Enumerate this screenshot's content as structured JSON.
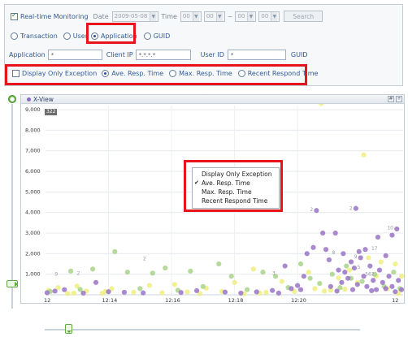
{
  "filters": {
    "realtime_label": "Real-time Monitoring",
    "date_label": "Date",
    "date_value": "2009-05-08",
    "time_label": "Time",
    "hour_from": "00",
    "min_from": "00",
    "tilde": "~",
    "hour_to": "00",
    "min_to": "00",
    "search_label": "Search",
    "view_options": [
      "Transaction",
      "User",
      "Application",
      "GUID"
    ],
    "application_label": "Application",
    "application_value": "*",
    "client_ip_label": "Client IP",
    "client_ip_value": "*.*.*.*",
    "user_id_label": "User ID",
    "user_id_value": "*",
    "guid_label": "GUID",
    "display_only_exception": "Display Only Exception",
    "ave_resp_time": "Ave. Resp. Time",
    "max_resp_time": "Max. Resp. Time",
    "recent_respond_time": "Recent Respond Time"
  },
  "chart_header": {
    "title": "X-View",
    "count_badge": "322"
  },
  "context_menu": {
    "items": [
      "Display Only Exception",
      "Ave. Resp. Time",
      "Max. Resp. Time",
      "Recent Respond Time"
    ],
    "checked": "Ave. Resp. Time"
  },
  "chart_data": {
    "type": "scatter",
    "title": "X-View",
    "xlabel": "",
    "ylabel": "",
    "x_ticks": [
      "12",
      "12:14",
      "12:16",
      "12:18",
      "12:20",
      "12"
    ],
    "y_ticks": [
      "1,000",
      "2,000",
      "3,000",
      "4,000",
      "5,000",
      "6,000",
      "7,000",
      "8,000",
      "9,000"
    ],
    "ylim": [
      0,
      9200
    ],
    "grid": true,
    "colors": {
      "purple": "#9a74c6",
      "green": "#a8d48a",
      "yellow": "#eeee80"
    },
    "series": [
      {
        "color": "purple",
        "points": [
          [
            12.05,
            100
          ],
          [
            12.3,
            180
          ],
          [
            12.6,
            250
          ],
          [
            13.2,
            80
          ],
          [
            13.6,
            600
          ],
          [
            14.0,
            150
          ],
          [
            14.5,
            120
          ],
          [
            15.1,
            90
          ],
          [
            16.3,
            110
          ],
          [
            16.8,
            200
          ],
          [
            17.7,
            130
          ],
          [
            18.2,
            80
          ],
          [
            18.7,
            140
          ],
          [
            19.2,
            210
          ],
          [
            19.6,
            1400
          ],
          [
            19.8,
            300
          ],
          [
            20.0,
            450
          ],
          [
            20.2,
            900
          ],
          [
            20.3,
            2000
          ],
          [
            20.5,
            2300
          ],
          [
            20.6,
            4100
          ],
          [
            20.8,
            3000
          ],
          [
            20.9,
            2200
          ],
          [
            21.0,
            1700
          ],
          [
            21.2,
            3000
          ],
          [
            21.3,
            1200
          ],
          [
            21.4,
            600
          ],
          [
            21.45,
            2000
          ],
          [
            21.5,
            1100
          ],
          [
            21.6,
            800
          ],
          [
            21.7,
            1600
          ],
          [
            21.8,
            1300
          ],
          [
            21.9,
            500
          ],
          [
            21.95,
            2100
          ],
          [
            22.0,
            1800
          ],
          [
            22.1,
            900
          ],
          [
            22.2,
            400
          ],
          [
            22.3,
            1400
          ],
          [
            22.4,
            700
          ],
          [
            22.5,
            250
          ],
          [
            22.6,
            1200
          ],
          [
            22.7,
            600
          ],
          [
            22.8,
            300
          ],
          [
            22.9,
            900
          ],
          [
            23.0,
            400
          ],
          [
            23.1,
            150
          ],
          [
            23.2,
            700
          ],
          [
            23.3,
            250
          ],
          [
            21.85,
            4200
          ],
          [
            22.15,
            2200
          ],
          [
            22.55,
            2800
          ],
          [
            22.8,
            1900
          ],
          [
            23.0,
            2900
          ],
          [
            23.15,
            3200
          ],
          [
            20.1,
            250
          ],
          [
            19.4,
            80
          ],
          [
            21.05,
            400
          ],
          [
            21.25,
            180
          ],
          [
            21.75,
            250
          ],
          [
            22.35,
            200
          ]
        ]
      },
      {
        "color": "green",
        "points": [
          [
            12.15,
            160
          ],
          [
            12.8,
            1150
          ],
          [
            13.1,
            260
          ],
          [
            13.5,
            1250
          ],
          [
            14.2,
            2100
          ],
          [
            14.6,
            1100
          ],
          [
            15.0,
            300
          ],
          [
            15.4,
            1050
          ],
          [
            15.8,
            1300
          ],
          [
            16.2,
            220
          ],
          [
            16.6,
            1150
          ],
          [
            17.0,
            400
          ],
          [
            17.5,
            1500
          ],
          [
            17.9,
            900
          ],
          [
            18.4,
            250
          ],
          [
            18.9,
            1100
          ],
          [
            19.3,
            900
          ],
          [
            19.7,
            350
          ],
          [
            20.1,
            1500
          ],
          [
            20.4,
            800
          ],
          [
            20.7,
            550
          ],
          [
            21.1,
            1000
          ],
          [
            21.35,
            350
          ],
          [
            21.55,
            1400
          ],
          [
            21.7,
            800
          ],
          [
            22.05,
            650
          ],
          [
            22.45,
            1000
          ],
          [
            22.75,
            400
          ],
          [
            23.05,
            1100
          ],
          [
            23.25,
            300
          ]
        ]
      },
      {
        "color": "yellow",
        "points": [
          [
            12.1,
            220
          ],
          [
            12.4,
            350
          ],
          [
            12.7,
            60
          ],
          [
            13.0,
            420
          ],
          [
            13.3,
            180
          ],
          [
            13.8,
            70
          ],
          [
            14.1,
            300
          ],
          [
            14.8,
            120
          ],
          [
            15.3,
            450
          ],
          [
            15.7,
            90
          ],
          [
            16.1,
            500
          ],
          [
            16.5,
            140
          ],
          [
            17.1,
            320
          ],
          [
            17.3,
            5300
          ],
          [
            17.6,
            160
          ],
          [
            18.0,
            600
          ],
          [
            18.3,
            50
          ],
          [
            18.6,
            1250
          ],
          [
            19.0,
            120
          ],
          [
            19.5,
            650
          ],
          [
            19.9,
            160
          ],
          [
            20.35,
            1100
          ],
          [
            20.55,
            300
          ],
          [
            20.85,
            180
          ],
          [
            21.05,
            220
          ],
          [
            21.3,
            820
          ],
          [
            21.5,
            270
          ],
          [
            21.65,
            1200
          ],
          [
            21.9,
            600
          ],
          [
            22.1,
            6800
          ],
          [
            22.25,
            1800
          ],
          [
            22.5,
            900
          ],
          [
            22.65,
            1600
          ],
          [
            22.85,
            300
          ],
          [
            23.1,
            1500
          ],
          [
            23.3,
            900
          ],
          [
            20.75,
            9300
          ],
          [
            12.9,
            80
          ],
          [
            13.9,
            160
          ],
          [
            16.9,
            60
          ],
          [
            18.8,
            80
          ],
          [
            23.2,
            60
          ]
        ]
      }
    ],
    "labeled_points": [
      {
        "x": 12.5,
        "y": 1000,
        "text": "9"
      },
      {
        "x": 15.3,
        "y": 1750,
        "text": "2"
      },
      {
        "x": 13.2,
        "y": 1050,
        "text": "2"
      },
      {
        "x": 19.4,
        "y": 1050,
        "text": "3"
      },
      {
        "x": 20.6,
        "y": 4150,
        "text": "2"
      },
      {
        "x": 21.85,
        "y": 4200,
        "text": "2"
      },
      {
        "x": 21.3,
        "y": 2050,
        "text": "8"
      },
      {
        "x": 23.05,
        "y": 3250,
        "text": "10"
      },
      {
        "x": 22.55,
        "y": 2250,
        "text": "17"
      },
      {
        "x": 22.35,
        "y": 1000,
        "text": "562"
      },
      {
        "x": 22.1,
        "y": 1350,
        "text": "5"
      },
      {
        "x": 22.0,
        "y": 1850,
        "text": "9"
      }
    ]
  }
}
